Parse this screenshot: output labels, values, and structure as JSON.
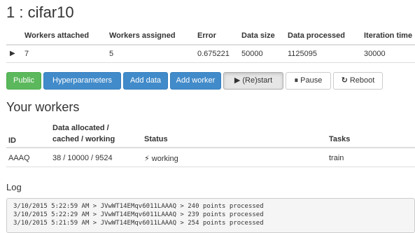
{
  "page": {
    "title": "1 : cifar10"
  },
  "project_table": {
    "headers": [
      "Workers attached",
      "Workers assigned",
      "Error",
      "Data size",
      "Data processed",
      "Iteration time"
    ],
    "row": {
      "expand_icon": "▶",
      "workers_attached": "7",
      "workers_assigned": "5",
      "error": "0.675221",
      "data_size": "50000",
      "data_processed": "1125095",
      "iteration_time": "30000"
    }
  },
  "buttons": {
    "public": "Public",
    "hyperparameters": "Hyperparameters",
    "add_data": "Add data",
    "add_worker": "Add worker",
    "restart": "(Re)start",
    "restart_icon": "▶",
    "pause": "Pause",
    "pause_icon": "⏸",
    "reboot": "Reboot",
    "reboot_icon": "↻"
  },
  "workers": {
    "heading": "Your workers",
    "headers": {
      "id": "ID",
      "data_line1": "Data allocated /",
      "data_line2": "cached / working",
      "status": "Status",
      "tasks": "Tasks"
    },
    "rows": [
      {
        "id": "AAAQ",
        "data": "38 / 10000 / 9524",
        "status_icon": "⚡",
        "status": "working",
        "tasks": "train"
      }
    ]
  },
  "log": {
    "heading": "Log",
    "lines": [
      "3/10/2015 5:22:59 AM > JVwWT14EMqv6011LAAAQ > 240 points processed",
      "3/10/2015 5:22:29 AM > JVwWT14EMqv6011LAAAQ > 239 points processed",
      "3/10/2015 5:21:59 AM > JVwWT14EMqv6011LAAAQ > 254 points processed"
    ]
  },
  "colors": {
    "success": "#5cb85c",
    "primary": "#428bca",
    "default": "#ffffff",
    "log_background": "#f5f5f5"
  }
}
